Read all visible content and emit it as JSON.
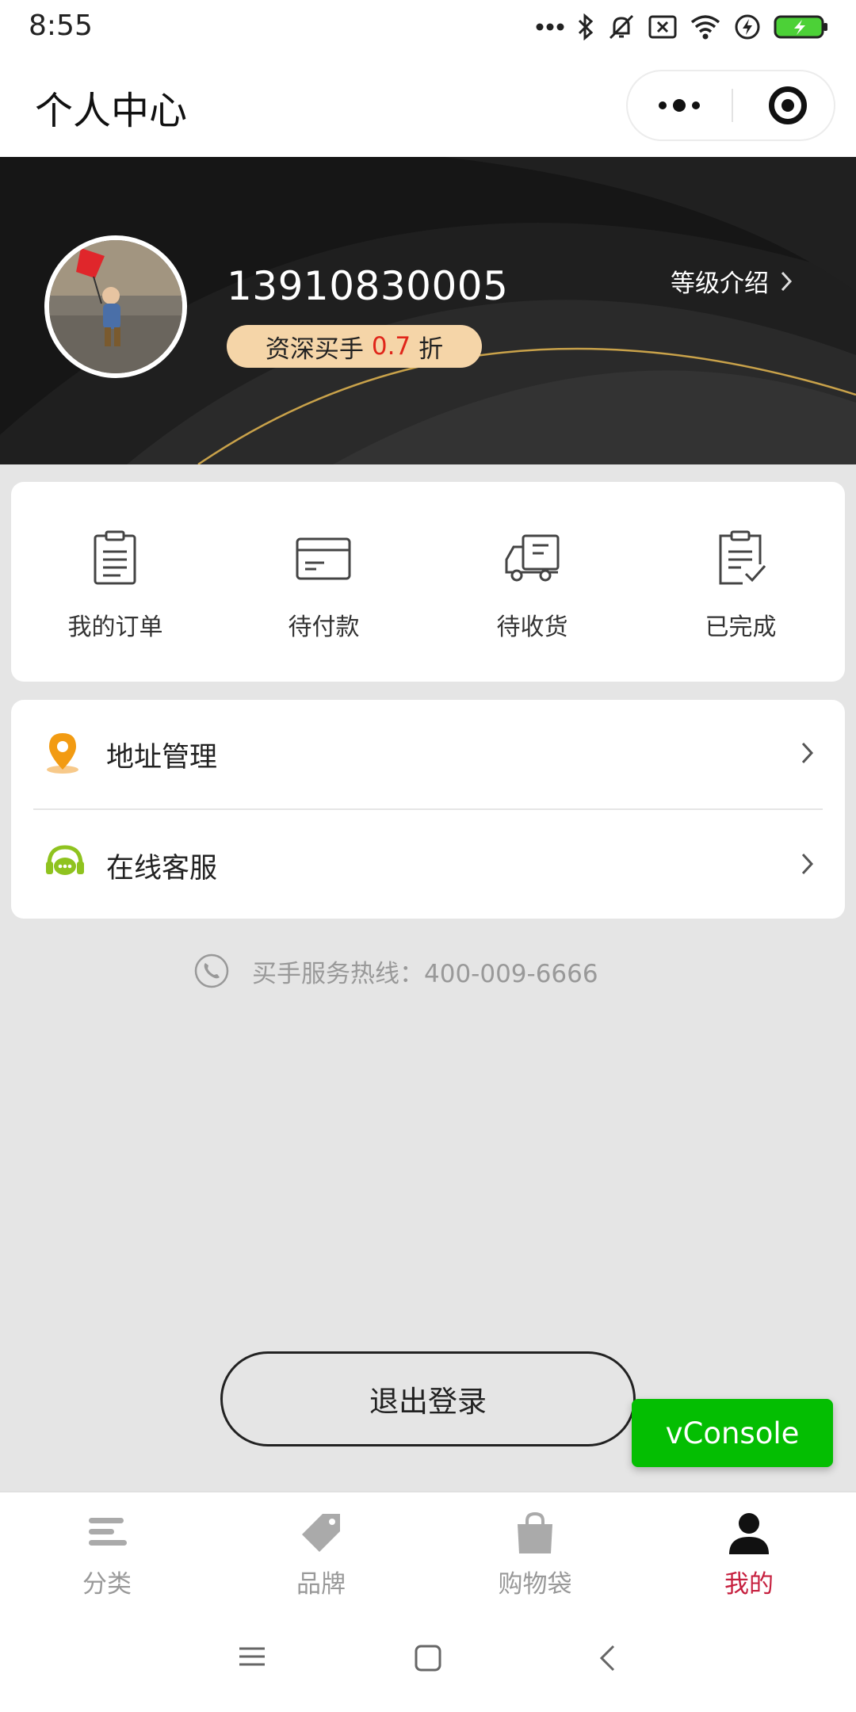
{
  "status_bar": {
    "time": "8:55",
    "icons": [
      "more-dots-icon",
      "bluetooth-icon",
      "silent-icon",
      "sim-icon",
      "wifi-icon",
      "charging-icon",
      "battery-icon"
    ]
  },
  "nav": {
    "title": "个人中心"
  },
  "profile": {
    "phone": "13910830005",
    "level_name": "资深买手",
    "discount_value": "0.7",
    "discount_unit": "折",
    "level_intro": "等级介绍"
  },
  "orders": [
    {
      "label": "我的订单",
      "icon": "clipboard-icon"
    },
    {
      "label": "待付款",
      "icon": "card-icon"
    },
    {
      "label": "待收货",
      "icon": "truck-icon"
    },
    {
      "label": "已完成",
      "icon": "clipboard-check-icon"
    }
  ],
  "menu": [
    {
      "label": "地址管理",
      "icon": "location-pin-icon"
    },
    {
      "label": "在线客服",
      "icon": "headset-chat-icon"
    }
  ],
  "hotline": {
    "text": "买手服务热线：400-009-6666"
  },
  "actions": {
    "logout": "退出登录",
    "vconsole": "vConsole"
  },
  "tabs": [
    {
      "label": "分类",
      "icon": "menu-lines-icon",
      "active": false
    },
    {
      "label": "品牌",
      "icon": "tag-icon",
      "active": false
    },
    {
      "label": "购物袋",
      "icon": "shopping-bag-icon",
      "active": false
    },
    {
      "label": "我的",
      "icon": "user-icon",
      "active": true
    }
  ],
  "colors": {
    "accent": "#c6203f",
    "badge": "#f5d5a8",
    "discount": "#e0261a",
    "vconsole": "#04be02",
    "pin": "#f29b12",
    "headset": "#8fc31f"
  }
}
